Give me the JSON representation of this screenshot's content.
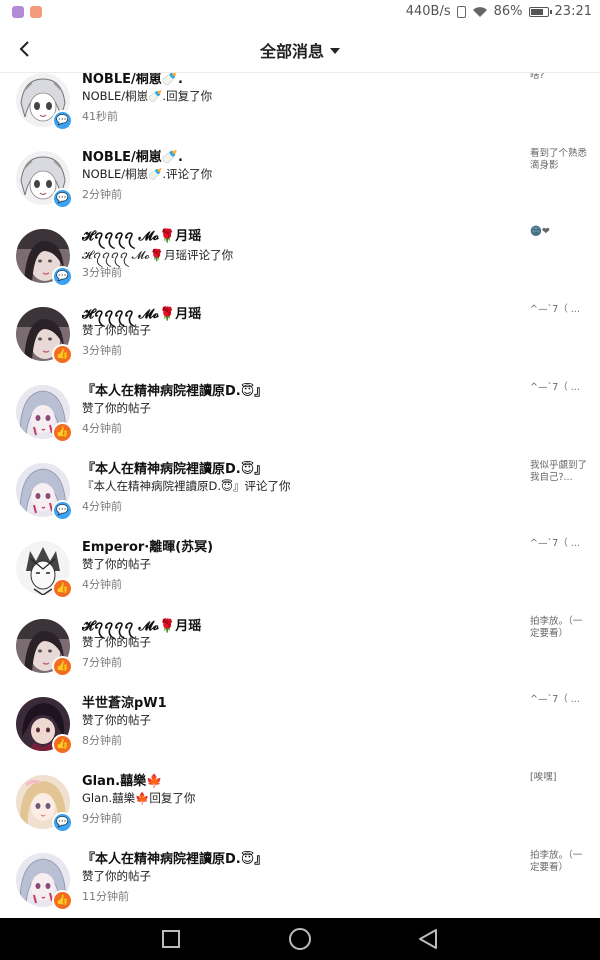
{
  "status_bar": {
    "net_speed": "440B/s",
    "battery": "86%",
    "battery_level": 0.86,
    "time": "23:21"
  },
  "header": {
    "title": "全部消息"
  },
  "messages": [
    {
      "name": "NOBLE/桐崽🍼.",
      "action": "NOBLE/桐崽🍼.回复了你",
      "time": "41秒前",
      "preview": "啥?",
      "badge": "comment",
      "avatar": "anime-white-hair"
    },
    {
      "name": "NOBLE/桐崽🍼.",
      "action": "NOBLE/桐崽🍼.评论了你",
      "time": "2分钟前",
      "preview": "看到了个熟悉滴身影",
      "badge": "comment",
      "avatar": "anime-white-hair"
    },
    {
      "name": "𝓗ꪖꪖꪖꪖ 𝓜𝓸🌹月瑶",
      "action": "𝓗ꪖꪖꪖꪖ 𝓜𝓸🌹月瑶评论了你",
      "time": "3分钟前",
      "preview": "🌚❤",
      "badge": "comment",
      "avatar": "photo-girl"
    },
    {
      "name": "𝓗ꪖꪖꪖꪖ 𝓜𝓸🌹月瑶",
      "action": "赞了你的帖子",
      "time": "3分钟前",
      "preview": "^—`7（ ...",
      "badge": "like",
      "avatar": "photo-girl"
    },
    {
      "name": "『本人在精神病院裡讀原D.😇』",
      "action": "赞了你的帖子",
      "time": "4分钟前",
      "preview": "^—`7（ ...",
      "badge": "like",
      "avatar": "anime-silver-bloody"
    },
    {
      "name": "『本人在精神病院裡讀原D.😇』",
      "action": "『本人在精神病院裡讀原D.😇』评论了你",
      "time": "4分钟前",
      "preview": "我似乎覷到了我自己?...",
      "badge": "comment",
      "avatar": "anime-silver-bloody"
    },
    {
      "name": "Emperor·離暉(苏冥)",
      "action": "赞了你的帖子",
      "time": "4分钟前",
      "preview": "^—`7（ ...",
      "badge": "like",
      "avatar": "sketch-boy"
    },
    {
      "name": "𝓗ꪖꪖꪖꪖ 𝓜𝓸🌹月瑶",
      "action": "赞了你的帖子",
      "time": "7分钟前",
      "preview": "拍李放。（一定要看）",
      "badge": "like",
      "avatar": "photo-girl"
    },
    {
      "name": "半世蒼涼pW1",
      "action": "赞了你的帖子",
      "time": "8分钟前",
      "preview": "^—`7（ ...",
      "badge": "like",
      "avatar": "anime-dark-boy"
    },
    {
      "name": "Glan.囍樂🍁",
      "action": "Glan.囍樂🍁回复了你",
      "time": "9分钟前",
      "preview": "[唉嘿]",
      "badge": "comment",
      "avatar": "doll-blonde"
    },
    {
      "name": "『本人在精神病院裡讀原D.😇』",
      "action": "赞了你的帖子",
      "time": "11分钟前",
      "preview": "拍李放。（一定要看）",
      "badge": "like",
      "avatar": "anime-silver-bloody"
    }
  ],
  "colors": {
    "comment_badge": "#3aa2f0",
    "like_badge": "#f36d21",
    "time_text": "#7a7a7a"
  }
}
